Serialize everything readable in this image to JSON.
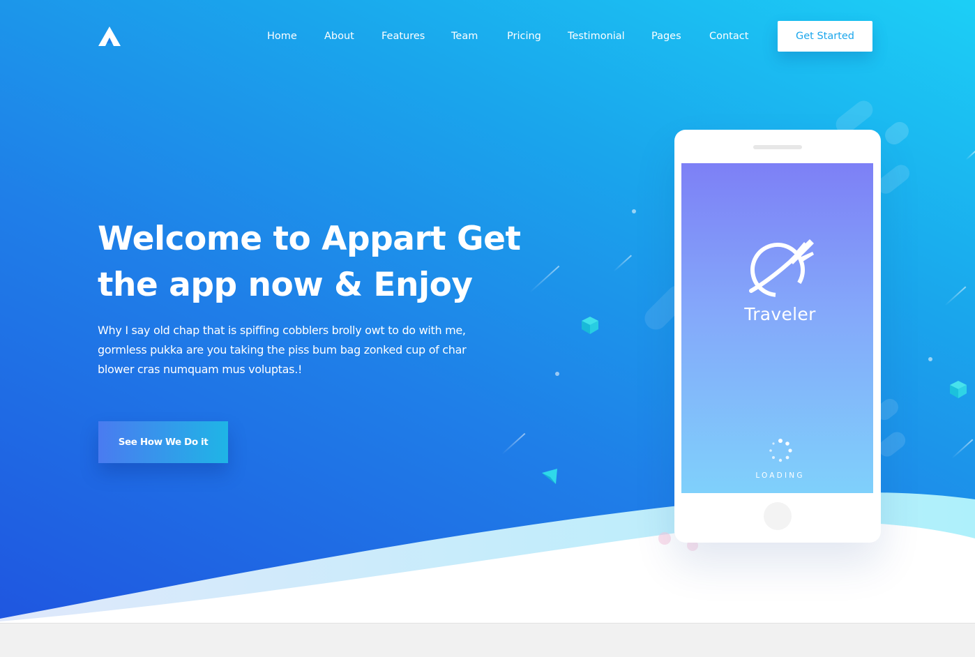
{
  "nav": {
    "logo_icon": "appart-logo-icon",
    "items": [
      {
        "label": "Home"
      },
      {
        "label": "About"
      },
      {
        "label": "Features"
      },
      {
        "label": "Team"
      },
      {
        "label": "Pricing"
      },
      {
        "label": "Testimonial"
      },
      {
        "label": "Pages"
      },
      {
        "label": "Contact"
      }
    ],
    "cta_label": "Get Started"
  },
  "hero": {
    "title_line1": "Welcome to Appart Get",
    "title_line2": "the app now & Enjoy",
    "description": "Why I say old chap that is spiffing cobblers brolly owt to do with me, gormless pukka are you taking the piss bum bag zonked cup of char blower cras numquam mus voluptas.!",
    "button_label": "See How We Do it"
  },
  "phone": {
    "app_icon": "globe-plane-icon",
    "app_name": "Traveler",
    "loading_text": "LOADING"
  },
  "colors": {
    "gradient_start": "#1f56e0",
    "gradient_end": "#1ccff6",
    "accent": "#1ba6ec",
    "button_start": "#4a7bf0",
    "button_end": "#1fb5e6"
  }
}
